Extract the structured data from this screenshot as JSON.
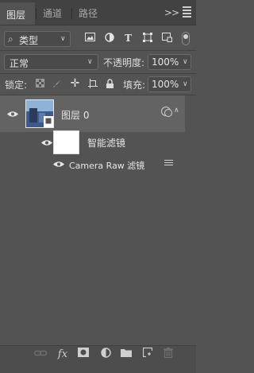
{
  "tabs": [
    {
      "label": "图层",
      "active": true
    },
    {
      "label": "通道",
      "active": false
    },
    {
      "label": "路径",
      "active": false
    }
  ],
  "panel_controls": {
    "collapse": ">>"
  },
  "filter": {
    "type_label": "类型",
    "icons": [
      "image-filter-icon",
      "adjustment-filter-icon",
      "type-filter-icon",
      "shape-filter-icon",
      "smart-object-filter-icon"
    ]
  },
  "blend": {
    "mode": "正常",
    "opacity_label": "不透明度:",
    "opacity_value": "100%"
  },
  "lock": {
    "label": "锁定:",
    "fill_label": "填充:",
    "fill_value": "100%"
  },
  "layers": [
    {
      "name": "图层 0"
    }
  ],
  "smart_filters": {
    "label": "智能滤镜",
    "items": [
      {
        "name": "Camera Raw 滤镜"
      }
    ]
  },
  "colors": {
    "panel_bg": "#535353",
    "selected_row": "#636363",
    "tab_bar": "#424242"
  }
}
